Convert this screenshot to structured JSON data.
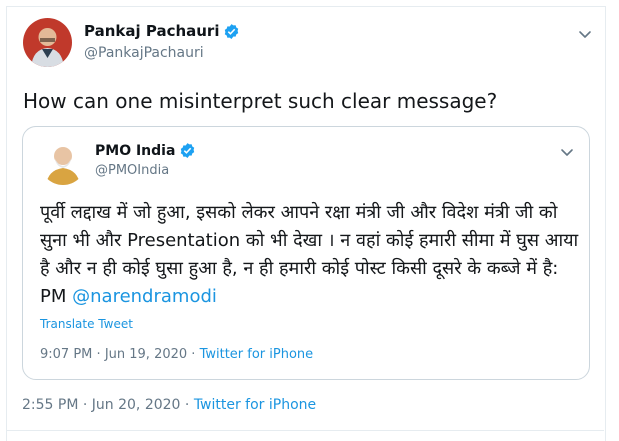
{
  "tweet": {
    "author_name": "Pankaj Pachauri",
    "author_handle": "@PankajPachauri",
    "text": "How can one misinterpret such clear message?",
    "time": "2:55 PM",
    "date": "Jun 20, 2020",
    "separator": "·",
    "source": "Twitter for iPhone"
  },
  "quoted_tweet": {
    "author_name": "PMO India",
    "author_handle": "@PMOIndia",
    "text": "पूर्वी लद्दाख में जो हुआ, इसको लेकर आपने रक्षा मंत्री जी और विदेश मंत्री जी को सुना भी और Presentation को भी देखा । न वहां कोई हमारी सीमा में घुस आया है और न ही कोई घुसा हुआ है, न ही हमारी कोई पोस्ट किसी दूसरे के कब्जे में है: PM",
    "mention": "@narendramodi",
    "translate_label": "Translate Tweet",
    "time": "9:07 PM",
    "date": "Jun 19, 2020",
    "separator": "·",
    "source": "Twitter for iPhone"
  },
  "icons": {
    "verified": "verified-badge-icon",
    "chevron": "chevron-down-icon"
  },
  "colors": {
    "link": "#1b95e0",
    "muted": "#657786",
    "border": "#ccd6dd"
  }
}
